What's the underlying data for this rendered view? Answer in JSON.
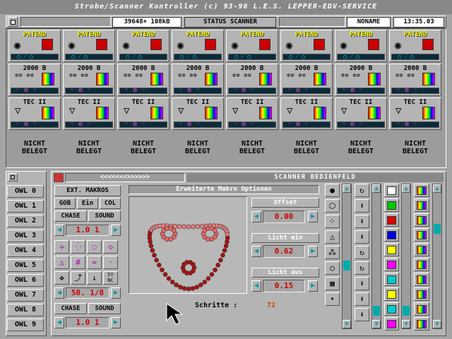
{
  "window": {
    "title": "Strobe/Scanner Kontroller (c) 93-96 L.E.S. LEPPER-EDV-SERVICE"
  },
  "statusbar": {
    "memory": "39648+ 108kB",
    "mode": "STATUS SCANNER",
    "name": "NONAME",
    "time": "13:35.03"
  },
  "devices": {
    "row1": [
      "PATEND",
      "PATEND",
      "PATEND",
      "PATEND",
      "PATEND",
      "PATEND",
      "PATEND",
      "PATEND"
    ],
    "row2": [
      "2000 B",
      "2000 B",
      "2000 B",
      "2000 B",
      "2000 B",
      "2000 B",
      "2000 B",
      "2000 B"
    ],
    "row3": [
      "TEC II",
      "TEC II",
      "TEC II",
      "TEC II",
      "TEC II",
      "TEC II",
      "TEC II",
      "TEC II"
    ],
    "row4_line1": [
      "NICHT",
      "NICHT",
      "NICHT",
      "NICHT",
      "NICHT",
      "NICHT",
      "NICHT",
      "NICHT"
    ],
    "row4_line2": [
      "BELEGT",
      "BELEGT",
      "BELEGT",
      "BELEGT",
      "BELEGT",
      "BELEGT",
      "BELEGT",
      "BELEGT"
    ]
  },
  "owl_list": [
    "OWL 0",
    "OWL 1",
    "OWL 2",
    "OWL 3",
    "OWL 4",
    "OWL 5",
    "OWL 6",
    "OWL 7",
    "OWL 8",
    "OWL 9"
  ],
  "scanner": {
    "title": "SCANNER BEDIENFELD",
    "nav": "<<<<<<<>>>>>>",
    "ext_makros": "EXT. MAKROS",
    "gob": "GOB",
    "ein": "Ein",
    "col": "COL",
    "chase": "CHASE",
    "sound": "SOUND",
    "spin1": "1.0 1",
    "spin2": "50. 1/8",
    "spin3": "1.0 1",
    "sync": "SY NC",
    "chase2": "CHASE",
    "sound2": "SOUND",
    "panel_title": "Erweiterte Makro Optionen",
    "offset_label": "Offset",
    "offset_value": "0.00",
    "licht_ein_label": "Licht ein",
    "licht_ein_value": "0.62",
    "licht_aus_label": "Licht aus",
    "licht_aus_value": "0.15",
    "schritte_label": "Schritte  :",
    "schritte_value": "72"
  },
  "colors": {
    "accent_red": "#cc0000",
    "patend_yellow": "#ffff00",
    "palette": [
      "#ffffff",
      "#00cc00",
      "#dd0000",
      "#0000dd",
      "#ffff00",
      "#ff00ff",
      "#00cccc",
      "#ffff00",
      "#00cccc",
      "#ff00ff"
    ]
  }
}
